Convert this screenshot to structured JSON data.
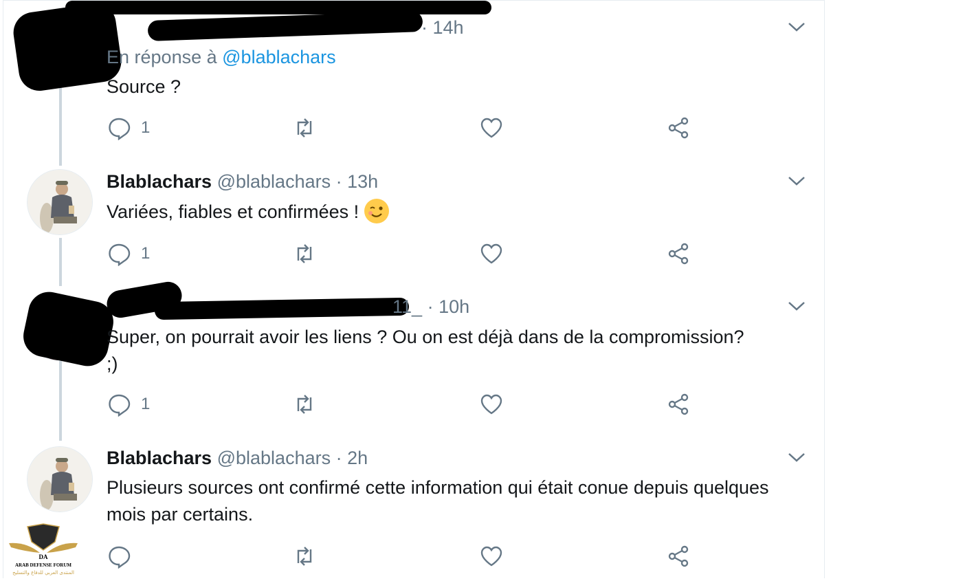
{
  "tweets": [
    {
      "time": "14h",
      "reply_prefix": "En réponse à",
      "reply_mention": "@blablachars",
      "text": "Source ?",
      "reply_count": "1"
    },
    {
      "name": "Blablachars",
      "handle": "@blablachars",
      "time": "13h",
      "text": "Variées, fiables et confirmées !",
      "emoji": "winking-face",
      "reply_count": "1"
    },
    {
      "handle_fragment": "11_",
      "time": "10h",
      "text": "Super, on pourrait avoir les liens ? Ou on est déjà dans de la compromission?\n;)",
      "reply_count": "1"
    },
    {
      "name": "Blablachars",
      "handle": "@blablachars",
      "time": "2h",
      "text": "Plusieurs sources ont confirmé cette information qui était conue depuis quelques mois par certains.",
      "reply_count": ""
    }
  ],
  "separator": "·",
  "watermark": {
    "logo_text": "DA",
    "line1": "ARAB DEFENSE FORUM",
    "line2": "المنتدى العربي للدفاع والتسليح"
  },
  "colors": {
    "text": "#14171a",
    "secondary": "#657786",
    "link": "#1b95e0",
    "thread_line": "#ccd6dd"
  }
}
